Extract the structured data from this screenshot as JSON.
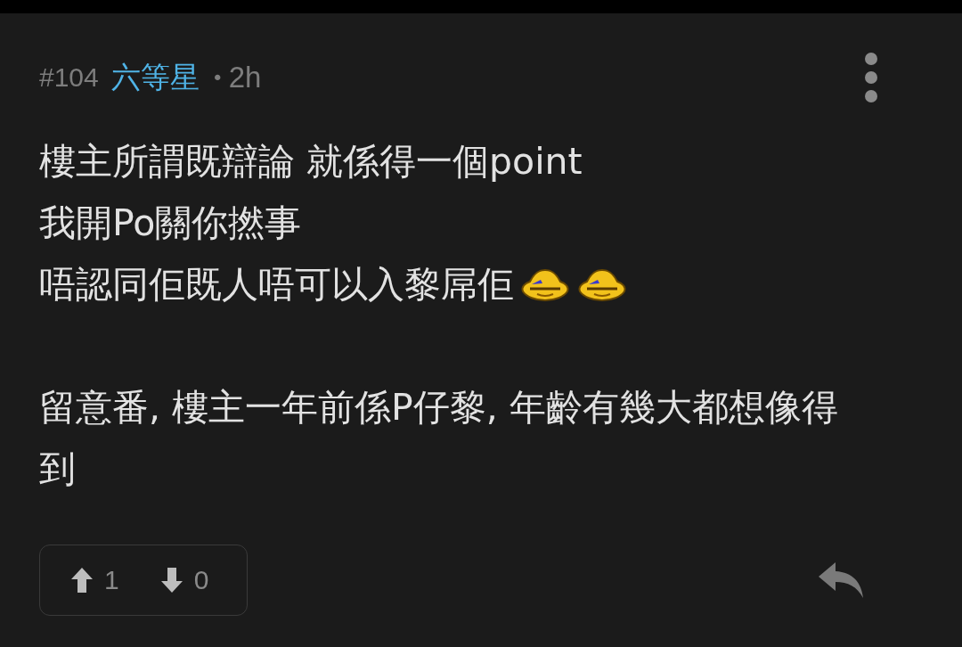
{
  "post": {
    "number": "#104",
    "author": "六等星",
    "separator": "•",
    "time": "2h"
  },
  "body": [
    {
      "text": "樓主所謂既辯論 就係得一個point"
    },
    {
      "text": "我開Po關你撚事"
    },
    {
      "text": "唔認同佢既人唔可以入黎屌佢",
      "emojis": [
        {
          "kind": "laugh"
        },
        {
          "kind": "laugh"
        }
      ]
    },
    {
      "text": "留意番, 樓主一年前係P仔黎, 年齡有幾大都想像得到",
      "gap": true
    }
  ],
  "votes": {
    "up": "1",
    "down": "0"
  }
}
